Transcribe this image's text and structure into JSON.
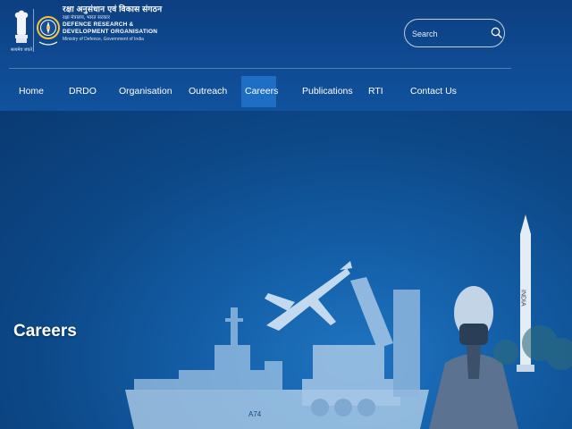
{
  "header": {
    "emblem_caption": "सत्यमेव जयते",
    "org_name_hindi": "रक्षा अनुसंधान एवं विकास संगठन",
    "ministry_hindi": "रक्षा मंत्रालय, भारत सरकार",
    "org_name_line1": "DEFENCE RESEARCH &",
    "org_name_line2": "DEVELOPMENT ORGANISATION",
    "ministry": "Ministry of Defence, Government of India",
    "search": {
      "placeholder": "Search"
    }
  },
  "nav": {
    "items": [
      {
        "label": "Home"
      },
      {
        "label": "DRDO"
      },
      {
        "label": "Organisation"
      },
      {
        "label": "Outreach"
      },
      {
        "label": "Careers",
        "active": true
      },
      {
        "label": "Publications"
      },
      {
        "label": "RTI"
      },
      {
        "label": "Contact Us"
      }
    ]
  },
  "hero": {
    "title": "Careers",
    "missile_marking": "INDIA",
    "ship_marking": "A74"
  },
  "colors": {
    "header_bg": "#0f4a92",
    "active_tab": "#1d6ec4",
    "hero_bg": "#145fa8"
  }
}
